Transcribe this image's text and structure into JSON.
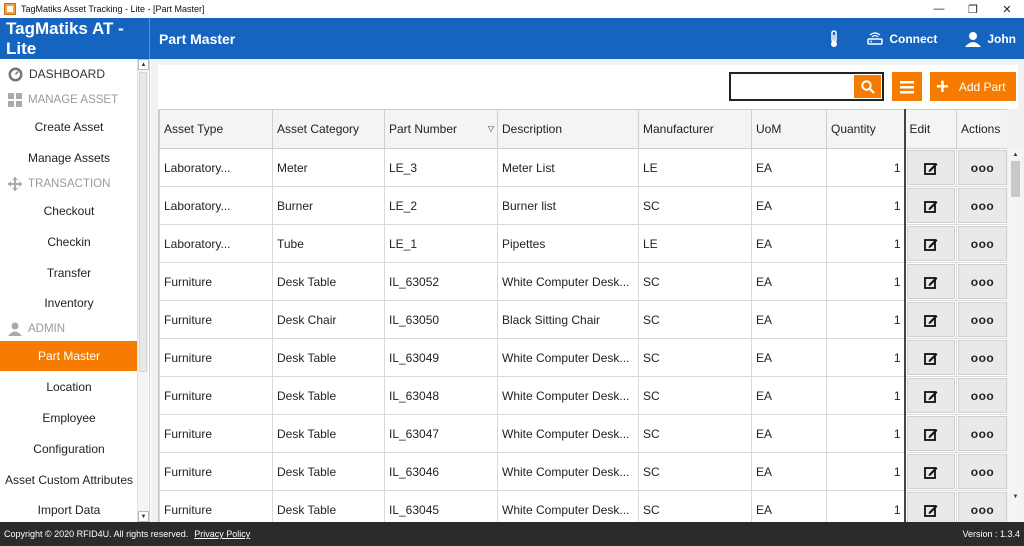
{
  "window": {
    "title": "TagMatiks Asset Tracking - Lite - [Part Master]",
    "minimize": "—",
    "restore": "❐",
    "close": "✕"
  },
  "header": {
    "brand": "TagMatiks AT - Lite",
    "page_title": "Part Master",
    "connect_label": "Connect",
    "user_label": "John",
    "bg_color": "#1565c0"
  },
  "sidebar": {
    "dashboard": "DASHBOARD",
    "manage_asset": "MANAGE ASSET",
    "create_asset": "Create Asset",
    "manage_assets": "Manage Assets",
    "transaction": "TRANSACTION",
    "checkout": "Checkout",
    "checkin": "Checkin",
    "transfer": "Transfer",
    "inventory": "Inventory",
    "admin": "ADMIN",
    "part_master": "Part Master",
    "location": "Location",
    "employee": "Employee",
    "configuration": "Configuration",
    "asset_custom_attributes": "Asset Custom Attributes",
    "import_data": "Import Data",
    "active_color": "#f57c00"
  },
  "toolbar": {
    "search_value": "",
    "add_part_label": "Add Part",
    "accent_color": "#f57c00"
  },
  "table": {
    "columns": {
      "asset_type": "Asset Type",
      "asset_category": "Asset Category",
      "part_number": "Part Number",
      "description": "Description",
      "manufacturer": "Manufacturer",
      "uom": "UoM",
      "quantity": "Quantity",
      "edit": "Edit",
      "actions": "Actions"
    },
    "rows": [
      {
        "type": "Laboratory...",
        "category": "Meter",
        "part": "LE_3",
        "desc": "Meter List",
        "mfr": "LE",
        "uom": "EA",
        "qty": "1"
      },
      {
        "type": "Laboratory...",
        "category": "Burner",
        "part": "LE_2",
        "desc": "Burner list",
        "mfr": "SC",
        "uom": "EA",
        "qty": "1"
      },
      {
        "type": "Laboratory...",
        "category": "Tube",
        "part": "LE_1",
        "desc": "Pipettes",
        "mfr": "LE",
        "uom": "EA",
        "qty": "1"
      },
      {
        "type": "Furniture",
        "category": "Desk Table",
        "part": "IL_63052",
        "desc": "White Computer Desk...",
        "mfr": "SC",
        "uom": "EA",
        "qty": "1"
      },
      {
        "type": "Furniture",
        "category": "Desk Chair",
        "part": "IL_63050",
        "desc": "Black Sitting Chair",
        "mfr": "SC",
        "uom": "EA",
        "qty": "1"
      },
      {
        "type": "Furniture",
        "category": "Desk Table",
        "part": "IL_63049",
        "desc": "White Computer Desk...",
        "mfr": "SC",
        "uom": "EA",
        "qty": "1"
      },
      {
        "type": "Furniture",
        "category": "Desk Table",
        "part": "IL_63048",
        "desc": "White Computer Desk...",
        "mfr": "SC",
        "uom": "EA",
        "qty": "1"
      },
      {
        "type": "Furniture",
        "category": "Desk Table",
        "part": "IL_63047",
        "desc": "White Computer Desk...",
        "mfr": "SC",
        "uom": "EA",
        "qty": "1"
      },
      {
        "type": "Furniture",
        "category": "Desk Table",
        "part": "IL_63046",
        "desc": "White Computer Desk...",
        "mfr": "SC",
        "uom": "EA",
        "qty": "1"
      },
      {
        "type": "Furniture",
        "category": "Desk Table",
        "part": "IL_63045",
        "desc": "White Computer Desk...",
        "mfr": "SC",
        "uom": "EA",
        "qty": "1"
      }
    ],
    "actions_glyph": "ooo"
  },
  "footer": {
    "copyright": "Copyright © 2020 RFID4U. All rights reserved.",
    "privacy": "Privacy Policy",
    "version": "Version : 1.3.4"
  }
}
